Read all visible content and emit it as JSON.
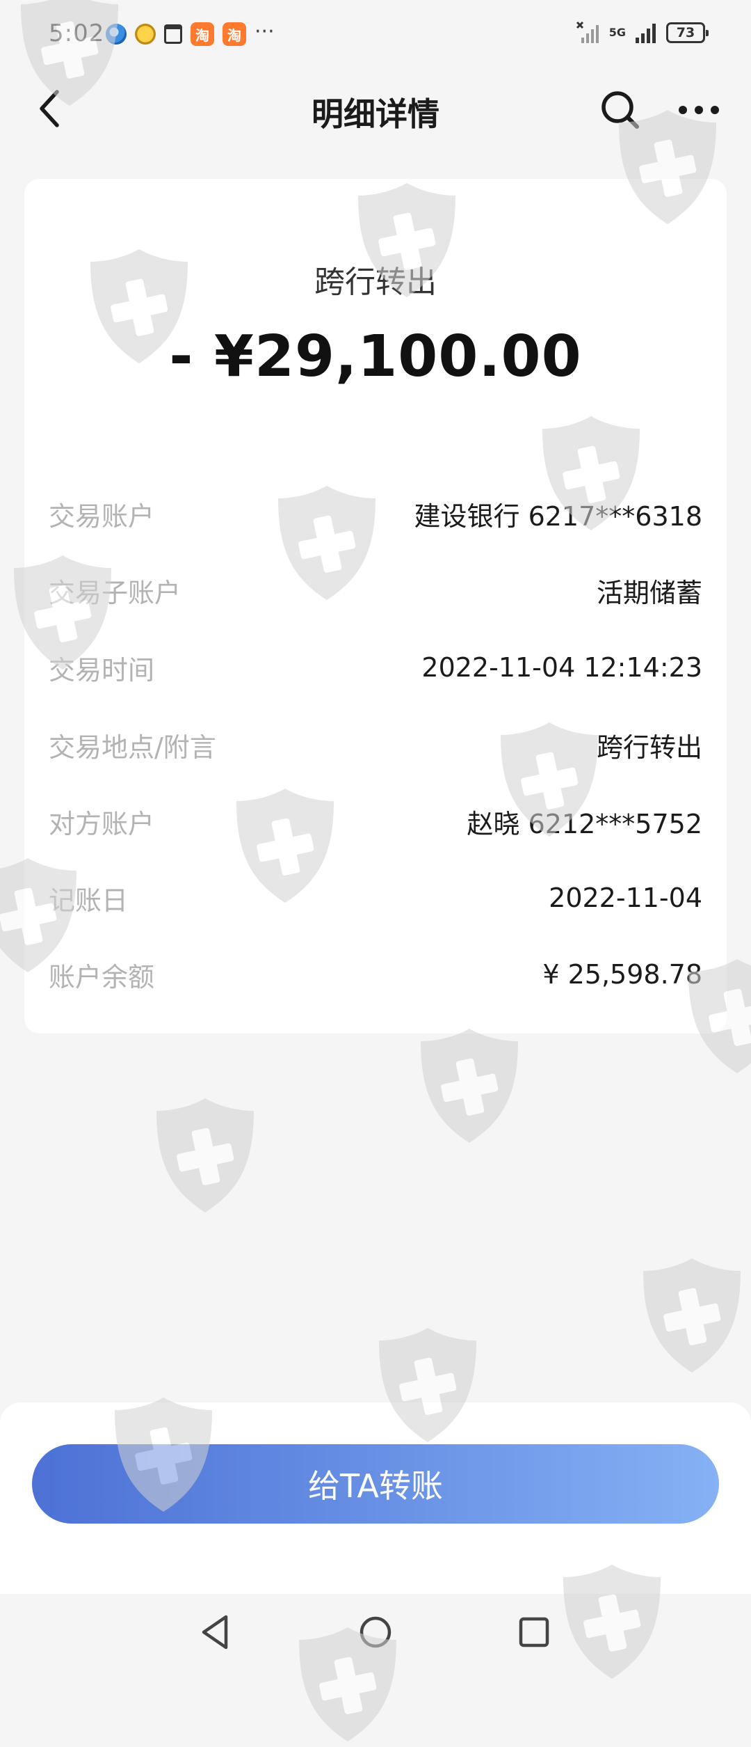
{
  "status_bar": {
    "time": "5:02",
    "left_icons": [
      "browser-icon",
      "pet-app-icon",
      "calendar-icon",
      "taobao-icon",
      "taobao-icon"
    ],
    "taobao_label": "淘",
    "more_notifications": "···",
    "network": "5G",
    "battery": "73"
  },
  "header": {
    "title": "明细详情"
  },
  "transaction": {
    "type": "跨行转出",
    "amount": "- ¥29,100.00"
  },
  "details": [
    {
      "label": "交易账户",
      "value": "建设银行 6217***6318"
    },
    {
      "label": "交易子账户",
      "value": "活期储蓄"
    },
    {
      "label": "交易时间",
      "value": "2022-11-04 12:14:23"
    },
    {
      "label": "交易地点/附言",
      "value": "跨行转出"
    },
    {
      "label": "对方账户",
      "value": "赵晓 6212***5752"
    },
    {
      "label": "记账日",
      "value": "2022-11-04"
    },
    {
      "label": "账户余额",
      "value": "¥ 25,598.78"
    }
  ],
  "actions": {
    "transfer_label": "给TA转账"
  },
  "colors": {
    "background": "#f5f5f5",
    "button_gradient_start": "#4d71d6",
    "button_gradient_end": "#86b1f4",
    "label_gray": "#b3b3b3",
    "watermark": "#d7d7d7"
  }
}
